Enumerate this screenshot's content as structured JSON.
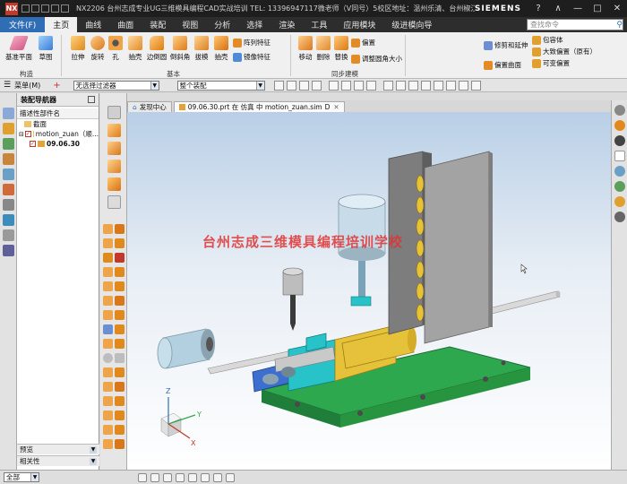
{
  "titlebar": {
    "logo": "NX",
    "title": "NX2206 台州志成专业UG三维模具编程CAD实战培训 TEL: 13396947117微老师（V同号）5校区地址：温州乐清、台州椒江三甲、玉环坎门、玉环沙门、玉环坎门 - 建模",
    "brand": "SIEMENS",
    "buttons": [
      "?",
      "∧",
      "⌃",
      "—",
      "□",
      "✕"
    ]
  },
  "menu": {
    "file_tab": "文件(F)",
    "tabs": [
      "主页",
      "曲线",
      "曲面",
      "装配",
      "视图",
      "分析",
      "选择",
      "渲染",
      "工具",
      "应用模块",
      "级进模向导"
    ],
    "active_tab": "主页",
    "search_placeholder": "查找命令"
  },
  "ribbon": {
    "sketch_group": {
      "items": [
        "基准平面",
        "草图"
      ],
      "label": "构造"
    },
    "feature_group": {
      "items": [
        "拉伸",
        "旋转",
        "孔",
        "抽壳",
        "边倒圆",
        "倒斜角",
        "拔模",
        "抽壳"
      ],
      "small": [
        "阵列特征",
        "镜像特征"
      ],
      "label": "基本"
    },
    "sync_group": {
      "items": [
        "移动",
        "删除",
        "替换"
      ],
      "small": [
        "偏置",
        "调整圆角大小"
      ],
      "label": "同步建模"
    },
    "extra_group": {
      "items": [
        "修剪和延伸",
        "偏置曲面"
      ],
      "small": [
        "包容体",
        "大致偏置（原有）",
        "可变偏置"
      ]
    }
  },
  "toolbar": {
    "menu_label": "菜单(M)",
    "filter_value": "无选择过滤器",
    "assembly_value": "整个装配"
  },
  "navigator": {
    "title": "装配导航器",
    "column": "描述性部件名",
    "nodes": [
      "截面",
      "motion_zuan（顺...",
      "09.06.30"
    ],
    "bottom": [
      "预览",
      "相关性"
    ],
    "footer": "全部"
  },
  "graphics": {
    "tabs": [
      {
        "label": "发现中心"
      },
      {
        "label": "09.06.30.prt 在 仿真 中 motion_zuan.sim",
        "suffix": "D"
      }
    ],
    "watermark": "台州志成三维模具编程培训学校",
    "axes": [
      "X",
      "Y",
      "Z"
    ]
  },
  "colors": {
    "accent": "#2f6db5",
    "titlebar": "#1e1e1e",
    "base_green": "#2ea84f",
    "block_cyan": "#27c3c9",
    "cylinder_gold": "#e6c23a",
    "plate_gray": "#9e9e9e",
    "motor_blue": "#b3d0e0",
    "clamp_blue": "#3d6fd1"
  }
}
